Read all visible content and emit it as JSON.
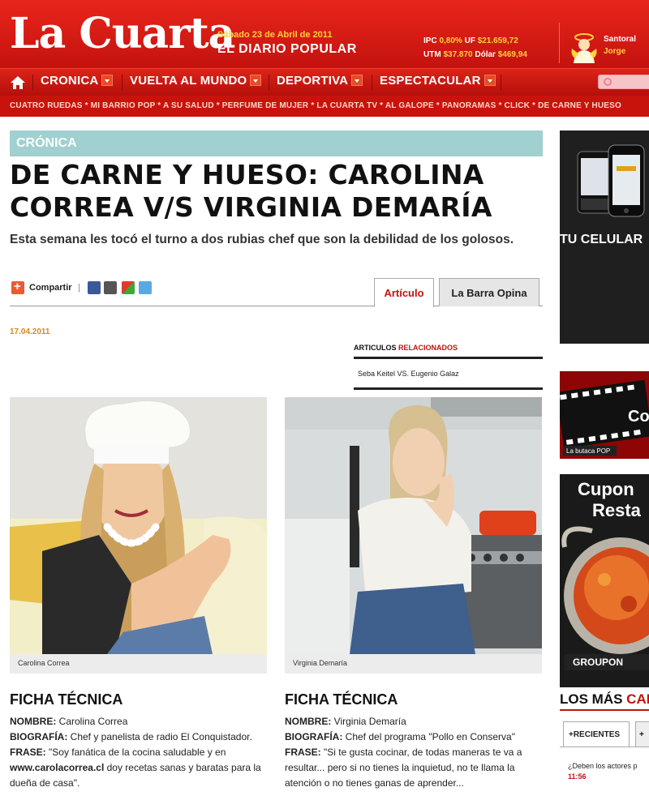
{
  "header": {
    "logo": "La Cuarta",
    "date": "Sábado 23 de Abril de 2011",
    "tagline": "EL DIARIO POPULAR",
    "indicators": [
      {
        "label": "IPC",
        "value": "0,80%"
      },
      {
        "label": "UF",
        "value": "$21.659,72"
      },
      {
        "label": "UTM",
        "value": "$37.870"
      },
      {
        "label": "Dólar",
        "value": "$469,94"
      }
    ],
    "santoral_label": "Santoral",
    "santoral_name": "Jorge"
  },
  "nav": {
    "items": [
      "CRONICA",
      "VUELTA AL MUNDO",
      "DEPORTIVA",
      "ESPECTACULAR"
    ],
    "subnav": "CUATRO RUEDAS * MI BARRIO POP * A SU SALUD * PERFUME DE MUJER * LA CUARTA TV * AL GALOPE * PANORAMAS * CLICK * DE CARNE Y HUESO"
  },
  "article": {
    "section": "CRÓNICA",
    "headline_line1": "DE CARNE Y HUESO: CAROLINA",
    "headline_line2": "CORREA V/S VIRGINIA DEMARÍA",
    "lede": "Esta semana les tocó el turno a dos rubias chef que son la debilidad de los golosos.",
    "share_label": "Compartir",
    "share_sep": "|",
    "tabs": {
      "active": "Artículo",
      "other": "La Barra Opina"
    },
    "date": "17.04.2011",
    "related": {
      "title_a": "ARTICULOS ",
      "title_b": "RELACIONADOS",
      "items": [
        "Seba Keitel VS. Eugenio Galaz"
      ]
    },
    "left": {
      "caption": "Carolina Correa",
      "ficha_title": "FICHA TÉCNICA",
      "nombre_label": "NOMBRE:",
      "nombre": " Carolina Correa",
      "bio_label": "BIOGRAFÍA:",
      "bio": " Chef y panelista de radio El Conquistador.",
      "frase_label": "FRASE:",
      "frase": " \"Soy fanática de la cocina saludable y en ",
      "frase_bold": "www.carolacorrea.cl",
      "frase_rest": " doy recetas sanas y baratas para la dueña de casa\"."
    },
    "right": {
      "caption": "Virginia Demaría",
      "ficha_title": "FICHA TÉCNICA",
      "nombre_label": "NOMBRE:",
      "nombre": " Virginia Demaría",
      "bio_label": "BIOGRAFÍA:",
      "bio": " Chef del programa \"Pollo en Conserva\"",
      "frase_label": "FRASE:",
      "frase": " \"Si te gusta cocinar, de todas maneras te va a resultar... pero si no tienes la inquietud, no te llama la atención o no tienes ganas de aprender..."
    }
  },
  "sidebar": {
    "ad1_text": "TU CELULAR",
    "ad3_line1": "Cupon",
    "ad3_line2": "Resta",
    "ad3_brand": "GROUPON",
    "ad2_brand": "La butaca POP",
    "losmas_a": "LOS MÁS ",
    "losmas_b": "CAL",
    "tab_recientes": "+RECIENTES",
    "tab_more": "+",
    "news": "¿Deben los actores p",
    "time": "11:56"
  },
  "colors": {
    "brand_red": "#c4120e",
    "section_teal": "#a0d0d0",
    "date_orange": "#d48a1c",
    "accent_yellow": "#ffd33a"
  }
}
